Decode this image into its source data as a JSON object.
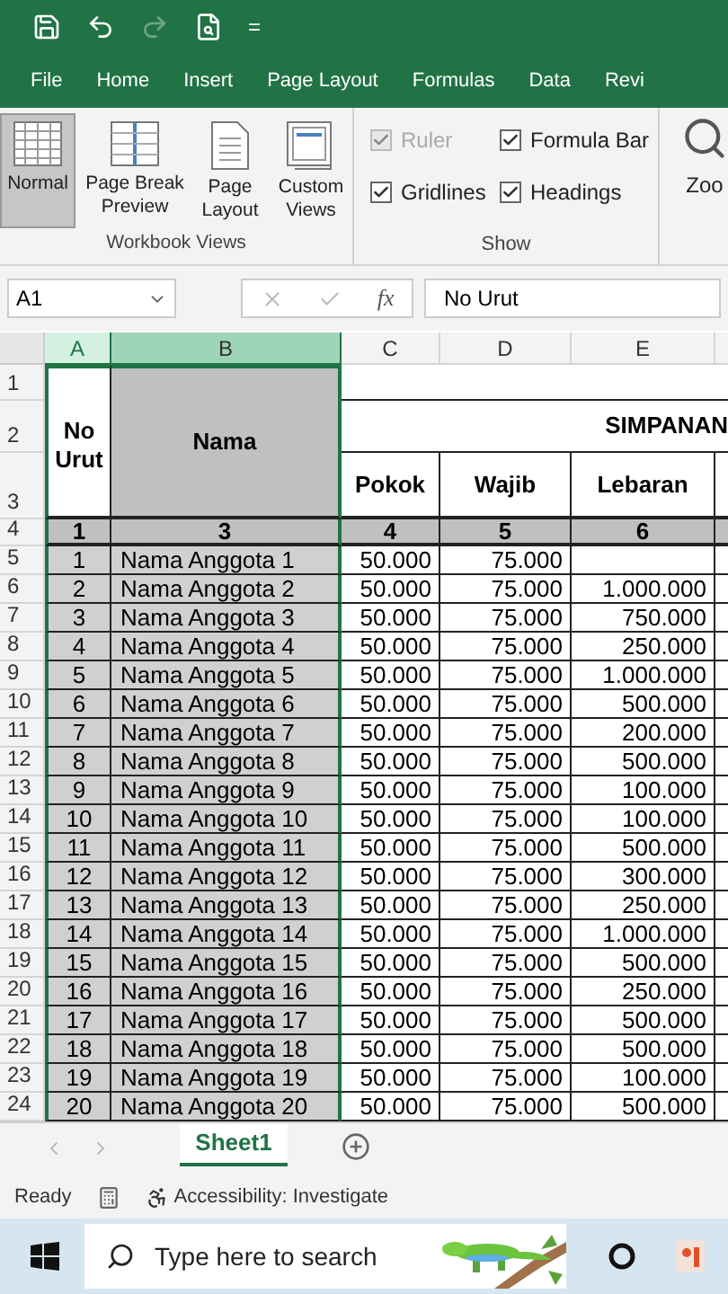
{
  "quick_access": {
    "customize": "="
  },
  "menu_tabs": [
    {
      "label": "File",
      "selected": false
    },
    {
      "label": "Home",
      "selected": false
    },
    {
      "label": "Insert",
      "selected": false
    },
    {
      "label": "Page Layout",
      "selected": false
    },
    {
      "label": "Formulas",
      "selected": false
    },
    {
      "label": "Data",
      "selected": false
    },
    {
      "label": "Revi",
      "selected": false
    }
  ],
  "ribbon": {
    "workbook_views": {
      "title": "Workbook Views",
      "buttons": [
        {
          "kind": "normal",
          "label": "Normal",
          "selected": true
        },
        {
          "kind": "pagebreak",
          "label": "Page Break Preview",
          "selected": false
        },
        {
          "kind": "pagelayout",
          "label": "Page Layout",
          "selected": false
        },
        {
          "kind": "custom",
          "label": "Custom Views",
          "selected": false
        }
      ]
    },
    "show": {
      "title": "Show",
      "options": [
        {
          "label": "Ruler",
          "checked": true,
          "disabled": true
        },
        {
          "label": "Formula Bar",
          "checked": true,
          "disabled": false
        },
        {
          "label": "Gridlines",
          "checked": true,
          "disabled": false
        },
        {
          "label": "Headings",
          "checked": true,
          "disabled": false
        }
      ]
    },
    "zoom": {
      "label": "Zoo"
    }
  },
  "formula_bar": {
    "name_box": "A1",
    "fx": "fx",
    "value": "No Urut"
  },
  "sheet": {
    "column_headers": [
      {
        "label": "A",
        "selected": true,
        "hover": false
      },
      {
        "label": "B",
        "selected": true,
        "hover": true
      },
      {
        "label": "C",
        "selected": false,
        "hover": false
      },
      {
        "label": "D",
        "selected": false,
        "hover": false
      },
      {
        "label": "E",
        "selected": false,
        "hover": false
      }
    ],
    "header_row_numbers": [
      "1",
      "2",
      "3",
      "4"
    ],
    "no_urut": "No Urut",
    "nama": "Nama",
    "simpanan": "SIMPANAN",
    "subheaders": [
      "Pokok",
      "Wajib",
      "Lebaran"
    ],
    "index_row": [
      "1",
      "3",
      "4",
      "5",
      "6"
    ],
    "rows": [
      {
        "row": "5",
        "no": "1",
        "nama": "Nama Anggota 1",
        "pokok": "50.000",
        "wajib": "75.000",
        "lebaran": ""
      },
      {
        "row": "6",
        "no": "2",
        "nama": "Nama Anggota 2",
        "pokok": "50.000",
        "wajib": "75.000",
        "lebaran": "1.000.000"
      },
      {
        "row": "7",
        "no": "3",
        "nama": "Nama Anggota 3",
        "pokok": "50.000",
        "wajib": "75.000",
        "lebaran": "750.000"
      },
      {
        "row": "8",
        "no": "4",
        "nama": "Nama Anggota 4",
        "pokok": "50.000",
        "wajib": "75.000",
        "lebaran": "250.000"
      },
      {
        "row": "9",
        "no": "5",
        "nama": "Nama Anggota 5",
        "pokok": "50.000",
        "wajib": "75.000",
        "lebaran": "1.000.000"
      },
      {
        "row": "10",
        "no": "6",
        "nama": "Nama Anggota 6",
        "pokok": "50.000",
        "wajib": "75.000",
        "lebaran": "500.000"
      },
      {
        "row": "11",
        "no": "7",
        "nama": "Nama Anggota 7",
        "pokok": "50.000",
        "wajib": "75.000",
        "lebaran": "200.000"
      },
      {
        "row": "12",
        "no": "8",
        "nama": "Nama Anggota 8",
        "pokok": "50.000",
        "wajib": "75.000",
        "lebaran": "500.000"
      },
      {
        "row": "13",
        "no": "9",
        "nama": "Nama Anggota 9",
        "pokok": "50.000",
        "wajib": "75.000",
        "lebaran": "100.000"
      },
      {
        "row": "14",
        "no": "10",
        "nama": "Nama Anggota 10",
        "pokok": "50.000",
        "wajib": "75.000",
        "lebaran": "100.000"
      },
      {
        "row": "15",
        "no": "11",
        "nama": "Nama Anggota 11",
        "pokok": "50.000",
        "wajib": "75.000",
        "lebaran": "500.000"
      },
      {
        "row": "16",
        "no": "12",
        "nama": "Nama Anggota 12",
        "pokok": "50.000",
        "wajib": "75.000",
        "lebaran": "300.000"
      },
      {
        "row": "17",
        "no": "13",
        "nama": "Nama Anggota 13",
        "pokok": "50.000",
        "wajib": "75.000",
        "lebaran": "250.000"
      },
      {
        "row": "18",
        "no": "14",
        "nama": "Nama Anggota 14",
        "pokok": "50.000",
        "wajib": "75.000",
        "lebaran": "1.000.000"
      },
      {
        "row": "19",
        "no": "15",
        "nama": "Nama Anggota 15",
        "pokok": "50.000",
        "wajib": "75.000",
        "lebaran": "500.000"
      },
      {
        "row": "20",
        "no": "16",
        "nama": "Nama Anggota 16",
        "pokok": "50.000",
        "wajib": "75.000",
        "lebaran": "250.000"
      },
      {
        "row": "21",
        "no": "17",
        "nama": "Nama Anggota 17",
        "pokok": "50.000",
        "wajib": "75.000",
        "lebaran": "500.000"
      },
      {
        "row": "22",
        "no": "18",
        "nama": "Nama Anggota 18",
        "pokok": "50.000",
        "wajib": "75.000",
        "lebaran": "500.000"
      },
      {
        "row": "23",
        "no": "19",
        "nama": "Nama Anggota 19",
        "pokok": "50.000",
        "wajib": "75.000",
        "lebaran": "100.000"
      },
      {
        "row": "24",
        "no": "20",
        "nama": "Nama Anggota 20",
        "pokok": "50.000",
        "wajib": "75.000",
        "lebaran": "500.000"
      }
    ]
  },
  "sheet_tabs": [
    {
      "label": "Sheet1",
      "selected": true
    }
  ],
  "status_bar": {
    "ready": "Ready",
    "accessibility": "Accessibility: Investigate"
  },
  "taskbar": {
    "search_placeholder": "Type here to search"
  }
}
